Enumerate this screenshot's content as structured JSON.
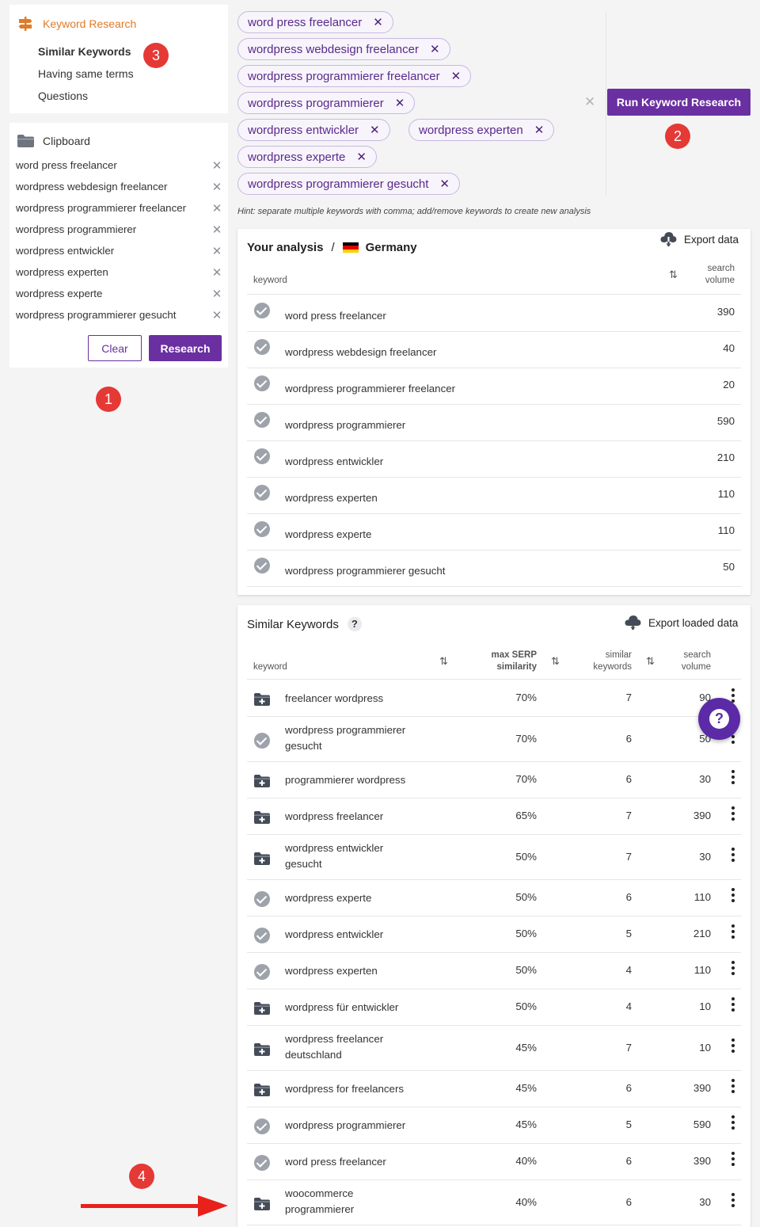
{
  "nav": {
    "title": "Keyword Research",
    "items": [
      {
        "label": "Similar Keywords",
        "active": true
      },
      {
        "label": "Having same terms",
        "active": false
      },
      {
        "label": "Questions",
        "active": false
      }
    ]
  },
  "clipboard": {
    "title": "Clipboard",
    "items": [
      "word press freelancer",
      "wordpress webdesign freelancer",
      "wordpress programmierer freelancer",
      "wordpress programmierer",
      "wordpress entwickler",
      "wordpress experten",
      "wordpress experte",
      "wordpress programmierer gesucht"
    ],
    "remove_glyph": "✕",
    "clear_label": "Clear",
    "research_label": "Research"
  },
  "badges": [
    "1",
    "2",
    "3",
    "4"
  ],
  "chips": {
    "items": [
      "word press freelancer",
      "wordpress webdesign freelancer",
      "wordpress programmierer freelancer",
      "wordpress programmierer",
      "wordpress entwickler",
      "wordpress experten",
      "wordpress experte",
      "wordpress programmierer gesucht"
    ],
    "remove_glyph": "✕",
    "clear_all_glyph": "✕",
    "run_label": "Run Keyword Research",
    "hint": "Hint: separate multiple keywords with comma; add/remove keywords to create new analysis"
  },
  "analysis": {
    "title": "Your analysis",
    "separator": "/",
    "country": "Germany",
    "flag_colors": [
      "#000000",
      "#dd0000",
      "#ffce00"
    ],
    "export_label": "Export data",
    "col_keyword": "keyword",
    "col_volume_1": "search",
    "col_volume_2": "volume",
    "sort_glyph": "⇅",
    "rows": [
      {
        "keyword": "word press freelancer",
        "volume": "390"
      },
      {
        "keyword": "wordpress webdesign freelancer",
        "volume": "40"
      },
      {
        "keyword": "wordpress programmierer freelancer",
        "volume": "20"
      },
      {
        "keyword": "wordpress programmierer",
        "volume": "590"
      },
      {
        "keyword": "wordpress entwickler",
        "volume": "210"
      },
      {
        "keyword": "wordpress experten",
        "volume": "110"
      },
      {
        "keyword": "wordpress experte",
        "volume": "110"
      },
      {
        "keyword": "wordpress programmierer gesucht",
        "volume": "50"
      }
    ]
  },
  "similar": {
    "title": "Similar Keywords",
    "help_glyph": "?",
    "export_label": "Export loaded data",
    "col_keyword": "keyword",
    "col_serp_1": "max SERP",
    "col_serp_2": "similarity",
    "col_similar_1": "similar",
    "col_similar_2": "keywords",
    "col_volume_1": "search",
    "col_volume_2": "volume",
    "sort_glyph": "⇅",
    "rows": [
      {
        "line1": "freelancer wordpress",
        "line2": "",
        "added": false,
        "serp": "70%",
        "similar": "7",
        "volume": "90"
      },
      {
        "line1": "wordpress programmierer",
        "line2": "gesucht",
        "added": true,
        "serp": "70%",
        "similar": "6",
        "volume": "50"
      },
      {
        "line1": "programmierer wordpress",
        "line2": "",
        "added": false,
        "serp": "70%",
        "similar": "6",
        "volume": "30"
      },
      {
        "line1": "wordpress freelancer",
        "line2": "",
        "added": false,
        "serp": "65%",
        "similar": "7",
        "volume": "390"
      },
      {
        "line1": "wordpress entwickler",
        "line2": "gesucht",
        "added": false,
        "serp": "50%",
        "similar": "7",
        "volume": "30"
      },
      {
        "line1": "wordpress experte",
        "line2": "",
        "added": true,
        "serp": "50%",
        "similar": "6",
        "volume": "110"
      },
      {
        "line1": "wordpress entwickler",
        "line2": "",
        "added": true,
        "serp": "50%",
        "similar": "5",
        "volume": "210"
      },
      {
        "line1": "wordpress experten",
        "line2": "",
        "added": true,
        "serp": "50%",
        "similar": "4",
        "volume": "110"
      },
      {
        "line1": "wordpress für entwickler",
        "line2": "",
        "added": false,
        "serp": "50%",
        "similar": "4",
        "volume": "10"
      },
      {
        "line1": "wordpress freelancer",
        "line2": "deutschland",
        "added": false,
        "serp": "45%",
        "similar": "7",
        "volume": "10"
      },
      {
        "line1": "wordpress for freelancers",
        "line2": "",
        "added": false,
        "serp": "45%",
        "similar": "6",
        "volume": "390"
      },
      {
        "line1": "wordpress programmierer",
        "line2": "",
        "added": true,
        "serp": "45%",
        "similar": "5",
        "volume": "590"
      },
      {
        "line1": "word press freelancer",
        "line2": "",
        "added": true,
        "serp": "40%",
        "similar": "6",
        "volume": "390"
      },
      {
        "line1": "woocommerce",
        "line2": "programmierer",
        "added": false,
        "serp": "40%",
        "similar": "6",
        "volume": "30"
      }
    ]
  },
  "help_fab_glyph": "?",
  "colors": {
    "accent": "#6a2fa0",
    "nav_accent": "#e07b28",
    "badge": "#e53935",
    "arrow": "#e8211b"
  }
}
